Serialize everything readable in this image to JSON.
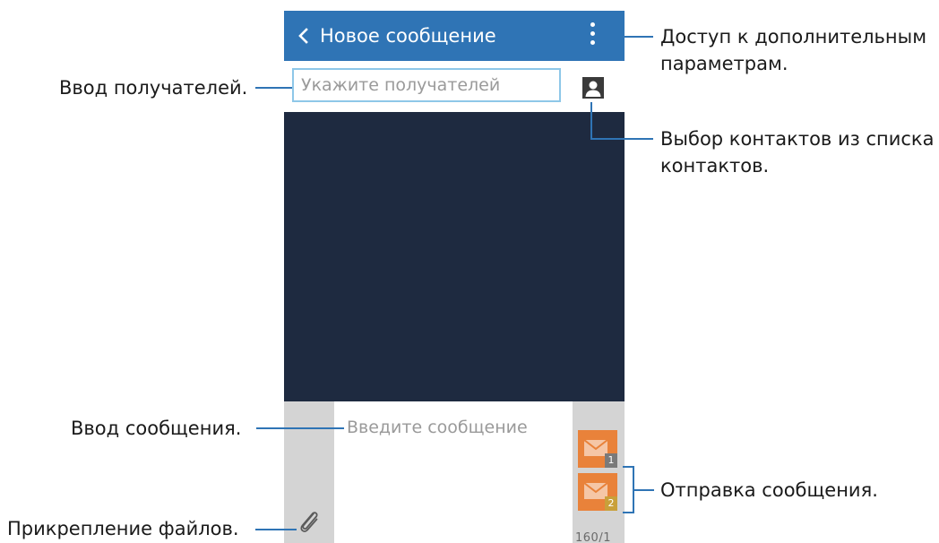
{
  "app_bar": {
    "title": "Новое сообщение"
  },
  "recipient": {
    "placeholder": "Укажите получателей"
  },
  "compose": {
    "placeholder": "Введите сообщение",
    "counter": "160/1",
    "send_sim1_badge": "1",
    "send_sim2_badge": "2"
  },
  "callouts": {
    "more_options": [
      "Доступ к дополнительным",
      "параметрам."
    ],
    "pick_contacts": [
      "Выбор контактов из списка",
      "контактов."
    ],
    "recipients": "Ввод получателей.",
    "message": "Ввод сообщения.",
    "attach": "Прикрепление файлов.",
    "send": "Отправка сообщения."
  },
  "colors": {
    "action_bar": "#2f74b5",
    "content_bg": "#1e2a40",
    "send_button": "#e9823a",
    "callout_line": "#2f74b5"
  },
  "icons": {
    "back": "chevron-left-icon",
    "menu": "more-vertical-icon",
    "contact": "contact-card-icon",
    "attach": "paperclip-icon",
    "send": "envelope-icon"
  }
}
